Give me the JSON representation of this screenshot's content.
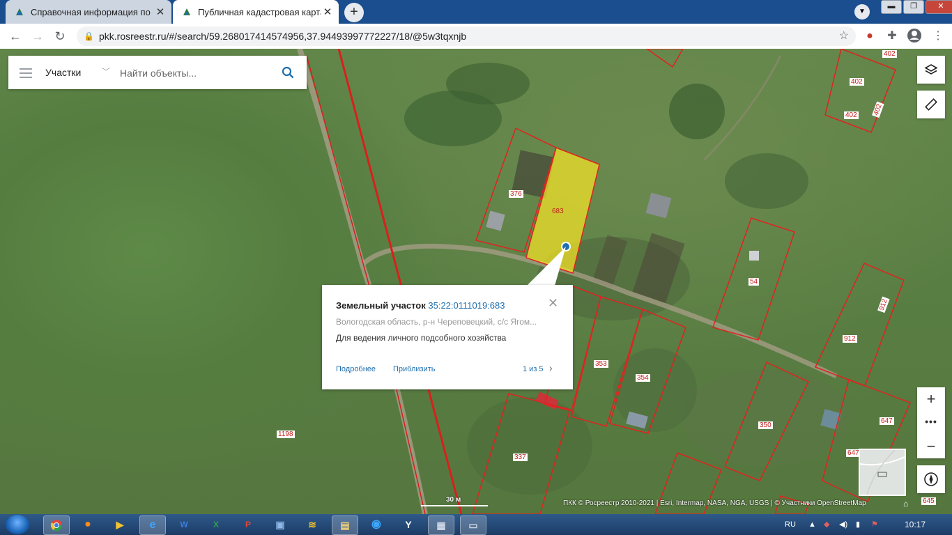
{
  "browser": {
    "tabs": [
      {
        "title": "Справочная информация по об",
        "close": "✕",
        "active": false
      },
      {
        "title": "Публичная кадастровая карта",
        "close": "✕",
        "active": true
      }
    ],
    "new_tab": "+",
    "url": "pkk.rosreestr.ru/#/search/59.268017414574956,37.94493997772227/18/@5w3tqxnjb",
    "window_controls": {
      "minimize": "▬",
      "maximize": "❐",
      "close": "✕"
    }
  },
  "search": {
    "category": "Участки",
    "placeholder": "Найти объекты..."
  },
  "parcel_labels": {
    "p376": "376",
    "p683": "683",
    "p54": "54",
    "p912a": "912",
    "p912b": "912",
    "p353": "353",
    "p354": "354",
    "p350": "350",
    "p337": "337",
    "p1198": "1198",
    "p647a": "647",
    "p647b": "647",
    "p645": "645",
    "p402a": "402",
    "p402b": "402",
    "p402c": "402",
    "p402d": "402"
  },
  "popup": {
    "type": "Земельный участок",
    "cadastral_number": "35:22:0111019:683",
    "address": "Вологодская область, р-н Череповецкий, с/с Ягом...",
    "usage": "Для ведения личного подсобного хозяйства",
    "details_link": "Подробнее",
    "zoom_link": "Приблизить",
    "pager": "1 из 5",
    "next": "›",
    "close": "✕"
  },
  "map_controls": {
    "zoom_in": "+",
    "more": "•••",
    "zoom_out": "−"
  },
  "scale_label": "30 м",
  "attribution": "ПКК © Росреестр 2010-2021 | Esri, Intermap, NASA, NGA, USGS | © Участники OpenStreetMap",
  "taskbar": {
    "language": "RU",
    "time": "10:17"
  },
  "colors": {
    "parcel_border": "#e0231f",
    "selected_fill": "#f0e028",
    "link": "#1f6fae"
  }
}
